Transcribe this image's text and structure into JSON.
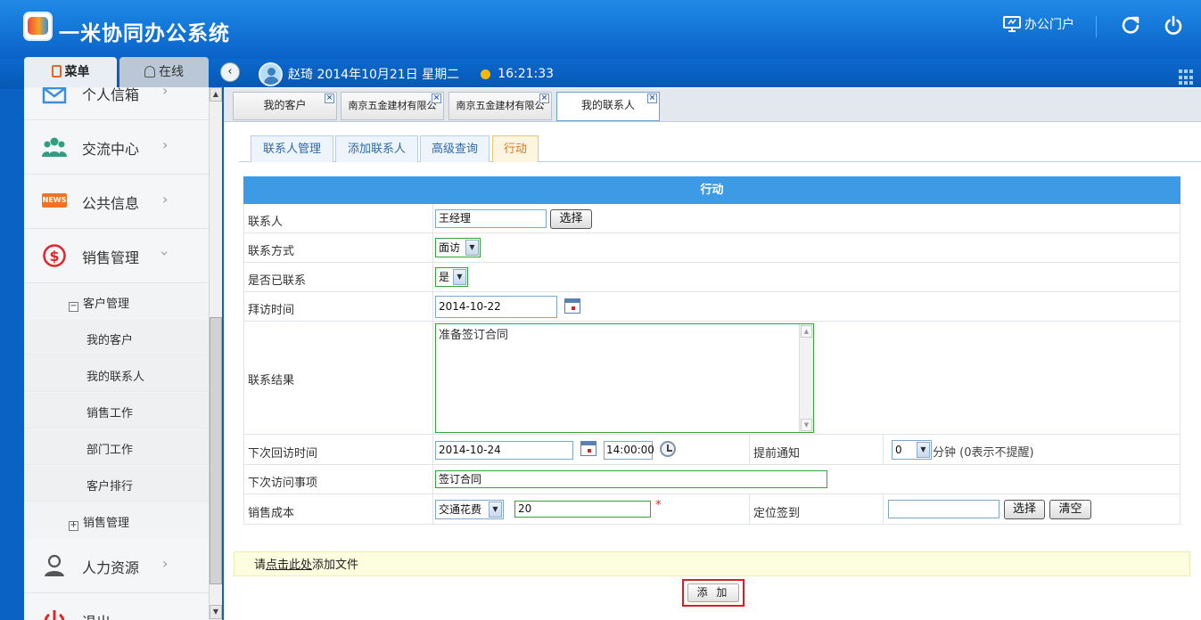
{
  "header": {
    "app_title": "一米协同办公系统",
    "portal_label": "办公门户",
    "menu_tab": "菜单",
    "online_tab": "在线"
  },
  "user_bar": {
    "user_info": "赵琦 2014年10月21日 星期二",
    "time": "16:21:33"
  },
  "sidebar": {
    "items": [
      {
        "label": "个人信箱",
        "icon": "mail-icon"
      },
      {
        "label": "交流中心",
        "icon": "people-icon"
      },
      {
        "label": "公共信息",
        "icon": "news-icon",
        "icon_text": "NEWS"
      },
      {
        "label": "销售管理",
        "icon": "dollar-icon"
      }
    ],
    "tree_customer": "客户管理",
    "sub_items": [
      "我的客户",
      "我的联系人",
      "销售工作",
      "部门工作",
      "客户排行"
    ],
    "tree_sales": "销售管理",
    "hr": {
      "label": "人力资源",
      "icon": "person-icon"
    },
    "logout": {
      "label": "退出",
      "icon": "power-icon"
    }
  },
  "doc_tabs": [
    {
      "label": "我的客户"
    },
    {
      "label": "南京五金建材有限公"
    },
    {
      "label": "南京五金建材有限公"
    },
    {
      "label": "我的联系人",
      "active": true
    }
  ],
  "sub_tabs": [
    {
      "label": "联系人管理"
    },
    {
      "label": "添加联系人"
    },
    {
      "label": "高级查询"
    },
    {
      "label": "行动",
      "active": true
    }
  ],
  "form": {
    "title": "行动",
    "contact_label": "联系人",
    "contact_value": "王经理",
    "select_btn": "选择",
    "method_label": "联系方式",
    "method_value": "面访",
    "contacted_label": "是否已联系",
    "contacted_value": "是",
    "visit_time_label": "拜访时间",
    "visit_time_value": "2014-10-22",
    "result_label": "联系结果",
    "result_value": "准备签订合同",
    "next_time_label": "下次回访时间",
    "next_date_value": "2014-10-24",
    "next_clock_value": "14:00:00",
    "remind_label": "提前通知",
    "remind_value": "0",
    "remind_unit": "分钟 (0表示不提醒)",
    "next_item_label": "下次访问事项",
    "next_item_value": "签订合同",
    "cost_label": "销售成本",
    "cost_type_value": "交通花费",
    "cost_amount_value": "20",
    "required_mark": "*",
    "location_label": "定位签到",
    "location_select_btn": "选择",
    "location_clear_btn": "清空"
  },
  "attach": {
    "prefix": "请",
    "link": "点击此处",
    "suffix": "添加文件"
  },
  "submit_label": "添 加",
  "colors": {
    "header_blue": "#0a62c8",
    "form_header": "#3d9be6",
    "active_subtab": "#e0771d",
    "required": "#e22222",
    "highlight_border": "#d81f26"
  }
}
